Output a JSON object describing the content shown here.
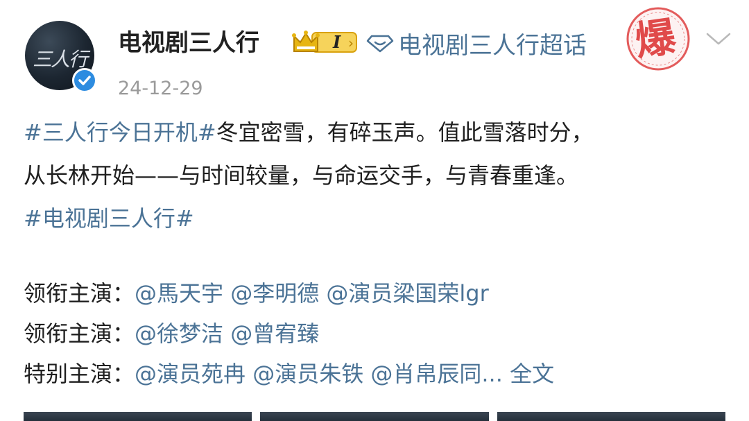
{
  "post": {
    "author": "电视剧三人行",
    "level_badge": "I",
    "topic_label": "电视剧三人行超话",
    "stamp_text": "爆",
    "timestamp": "24-12-29",
    "avatar_text": "三人行",
    "body_lines": {
      "line1_tag": "#三人行今日开机#",
      "line1_text": "冬宜密雪，有碎玉声。值此雪落时分，",
      "line2_text": "从长林开始——与时间较量，与命运交手，与青春重逢。",
      "line3_tag": "#电视剧三人行#"
    },
    "credits": [
      {
        "label": "领衔主演：",
        "mentions": "@馬天宇 @李明德 @演员梁国荣lgr"
      },
      {
        "label": "领衔主演：",
        "mentions": "@徐梦洁 @曾宥臻"
      },
      {
        "label": "特别主演：",
        "mentions": "@演员苑冉 @演员朱铁 @肖帛辰同...",
        "more": "全文"
      }
    ]
  },
  "colors": {
    "link": "#4b7396",
    "text": "#1f1f1f",
    "muted": "#9a9a9a",
    "verified": "#2d8ce0",
    "stamp": "#e04a4a",
    "crown": "#e7b512"
  },
  "icons": {
    "crown": "crown-icon",
    "topic": "diamond-icon",
    "verified": "checkmark-icon",
    "more": "chevron-down-icon"
  }
}
